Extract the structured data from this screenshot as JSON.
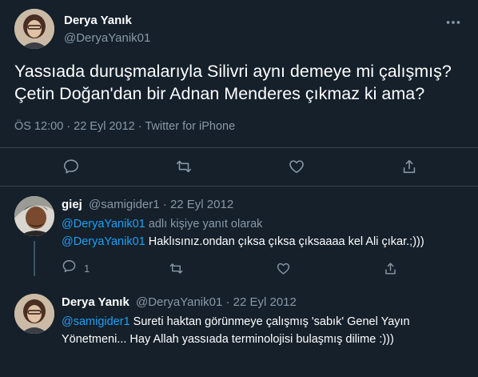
{
  "main_tweet": {
    "name": "Derya Yanık",
    "handle": "@DeryaYanik01",
    "text_line1": "Yassıada duruşmalarıyla Silivri aynı demeye mi çalışmış?",
    "text_line2": "Çetin Doğan'dan bir Adnan Menderes çıkmaz ki ama?",
    "meta": "ÖS 12:00 · 22 Eyl 2012 · Twitter for iPhone"
  },
  "replies": [
    {
      "name": "giej",
      "meta": "@samigider1 · 22 Eyl 2012",
      "reply_to_mention": "@DeryaYanik01",
      "reply_to_suffix": " adlı kişiye yanıt olarak",
      "mention": "@DeryaYanik01",
      "text": " Haklısınız.ondan çıksa çıksa çıksaaaa kel Ali çıkar.;)))",
      "reply_count": "1"
    },
    {
      "name": "Derya Yanık",
      "meta": "@DeryaYanik01 · 22 Eyl 2012",
      "mention": "@samigider1",
      "text_line1": " Sureti haktan görünmeye çalışmış 'sabık' Genel Yayın",
      "text_line2": "Yönetmeni... Hay Allah yassıada terminolojisi bulaşmış dilime :)))"
    }
  ],
  "icons": [
    "reply-icon",
    "retweet-icon",
    "like-icon",
    "share-icon",
    "more-icon"
  ],
  "colors": {
    "background": "#15202b",
    "accent": "#1da1f2",
    "secondary_text": "#8899a6",
    "divider": "#38444d"
  }
}
